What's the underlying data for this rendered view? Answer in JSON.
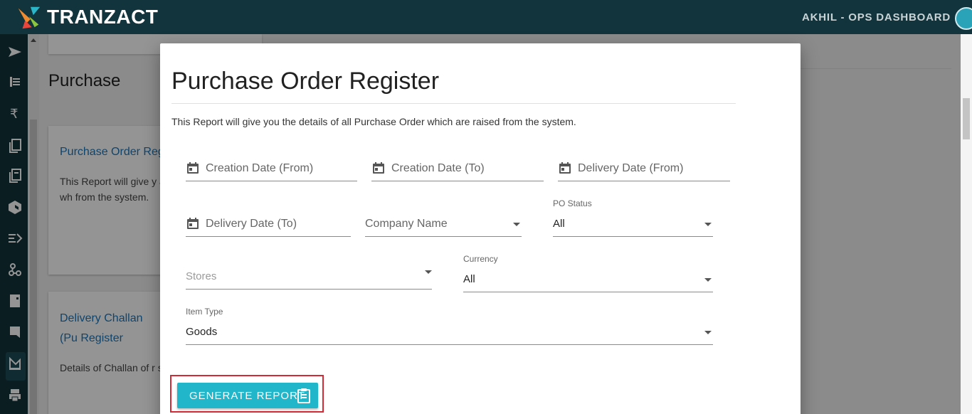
{
  "app": {
    "brand": "TRANZACT",
    "user_label": "AKHIL - OPS DASHBOARD"
  },
  "sidebar": {
    "icons": [
      "send-icon",
      "list-icon",
      "rupee-icon",
      "copy-icon",
      "documents-icon",
      "box-icon",
      "dispatch-icon",
      "network-icon",
      "ledger-icon",
      "bookmark-icon",
      "chart-icon",
      "print-icon"
    ]
  },
  "background_page": {
    "section_title": "Purchase",
    "cards": [
      {
        "title": "Purchase Order Reg",
        "desc": "This Report will give y all Purchase Order wh from the system."
      },
      {
        "title": "Delivery Challan (Pu Register",
        "desc": "Details of Challan of r sent to the supplier a"
      }
    ]
  },
  "modal": {
    "title": "Purchase Order Register",
    "description": "This Report will give you the details of all Purchase Order which are raised from the system.",
    "fields": {
      "creation_from": {
        "placeholder": "Creation Date (From)",
        "icon": "calendar-icon"
      },
      "creation_to": {
        "placeholder": "Creation Date (To)",
        "icon": "calendar-icon"
      },
      "delivery_from": {
        "placeholder": "Delivery Date (From)",
        "icon": "calendar-icon"
      },
      "delivery_to": {
        "placeholder": "Delivery Date (To)",
        "icon": "calendar-icon"
      },
      "company": {
        "placeholder": "Company Name"
      },
      "po_status": {
        "label": "PO Status",
        "value": "All"
      },
      "stores": {
        "placeholder": "Stores"
      },
      "currency": {
        "label": "Currency",
        "value": "All"
      },
      "item_type": {
        "label": "Item Type",
        "value": "Goods"
      }
    },
    "generate_button": {
      "label": "GENERATE REPORT",
      "icon": "clipboard-icon"
    }
  },
  "colors": {
    "topbar": "#12343c",
    "button": "#21b6c9",
    "highlight": "#d42a35",
    "link": "#1b75bb"
  }
}
